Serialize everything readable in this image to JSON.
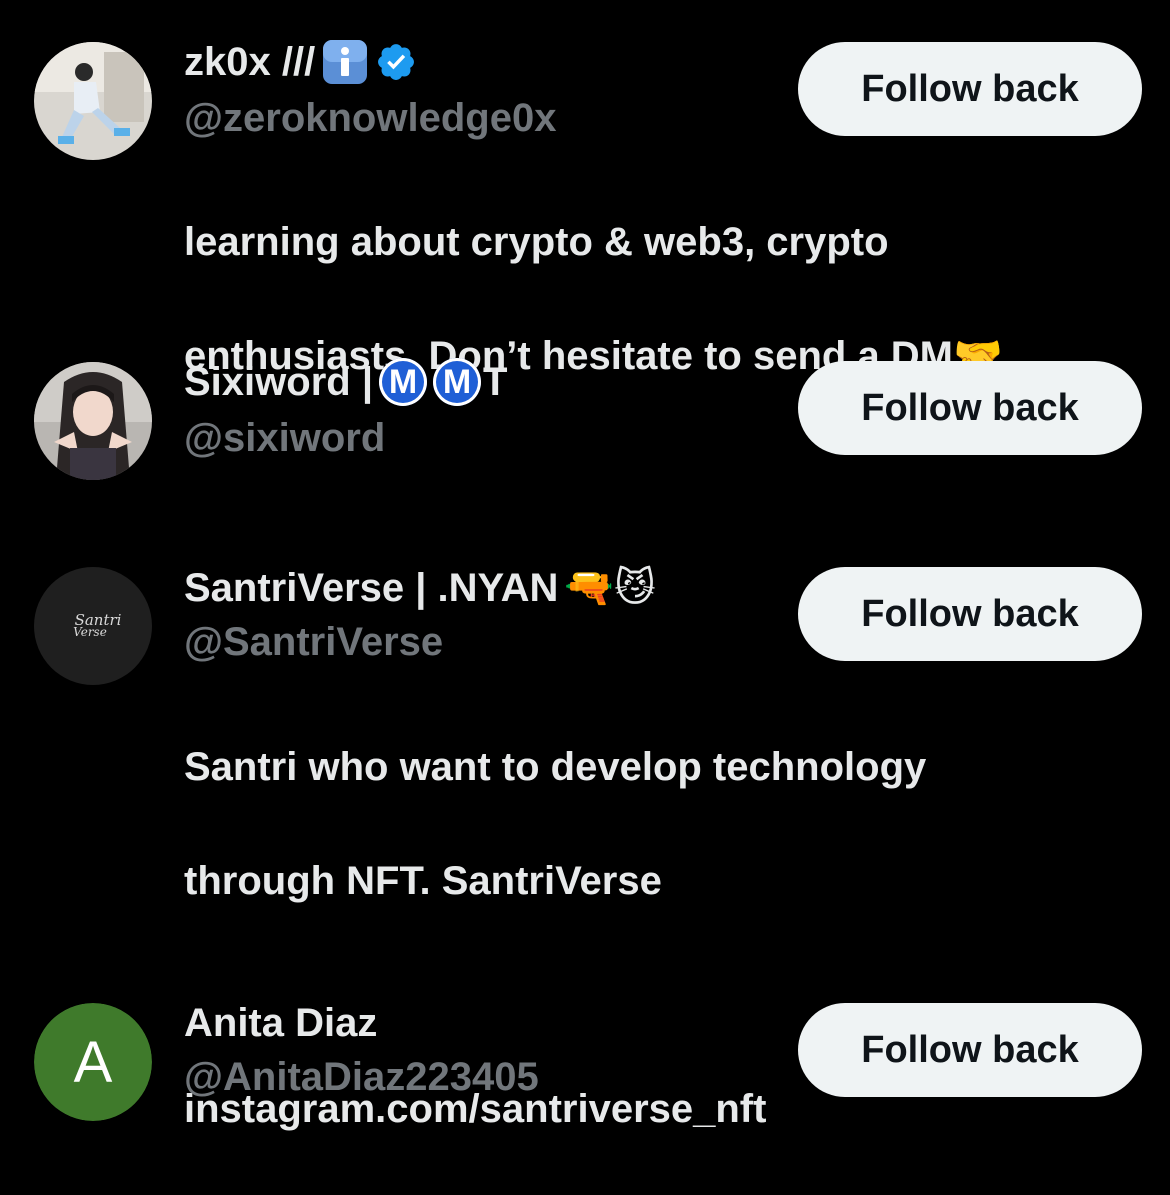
{
  "users": [
    {
      "name_parts": {
        "text": "zk0x ///",
        "info_icon": "info-emoji",
        "verified_icon": "verified-badge"
      },
      "handle": "@zeroknowledge0x",
      "bio_line1": "learning about crypto & web3, crypto",
      "bio_line2": "enthusiasts. Don’t hesitate to send a DM",
      "bio_emoji": "🤝",
      "button": "Follow back"
    },
    {
      "name_text": "Sixiword |",
      "badge1": "M",
      "badge2": "M",
      "name_suffix": "T",
      "handle": "@sixiword",
      "button": "Follow back"
    },
    {
      "name_text": "SantriVerse | .NYAN",
      "name_emojis": "🔫😼",
      "avatar_logo": "Santri Verse",
      "handle": "@SantriVerse",
      "bio_line1": "Santri who want to develop technology",
      "bio_line2": "through NFT. SantriVerse",
      "bio_link": "instagram.com/santriverse_nft",
      "button": "Follow back"
    },
    {
      "name_text": "Anita Diaz",
      "avatar_letter": "A",
      "avatar_color": "#3f7a2b",
      "handle": "@AnitaDiaz223405",
      "button": "Follow back"
    }
  ],
  "colors": {
    "background": "#000000",
    "primary_text": "#e7e9ea",
    "secondary_text": "#71767b",
    "button_bg": "#eff3f4",
    "button_text": "#0f1419",
    "verified_blue": "#1d9bf0"
  }
}
